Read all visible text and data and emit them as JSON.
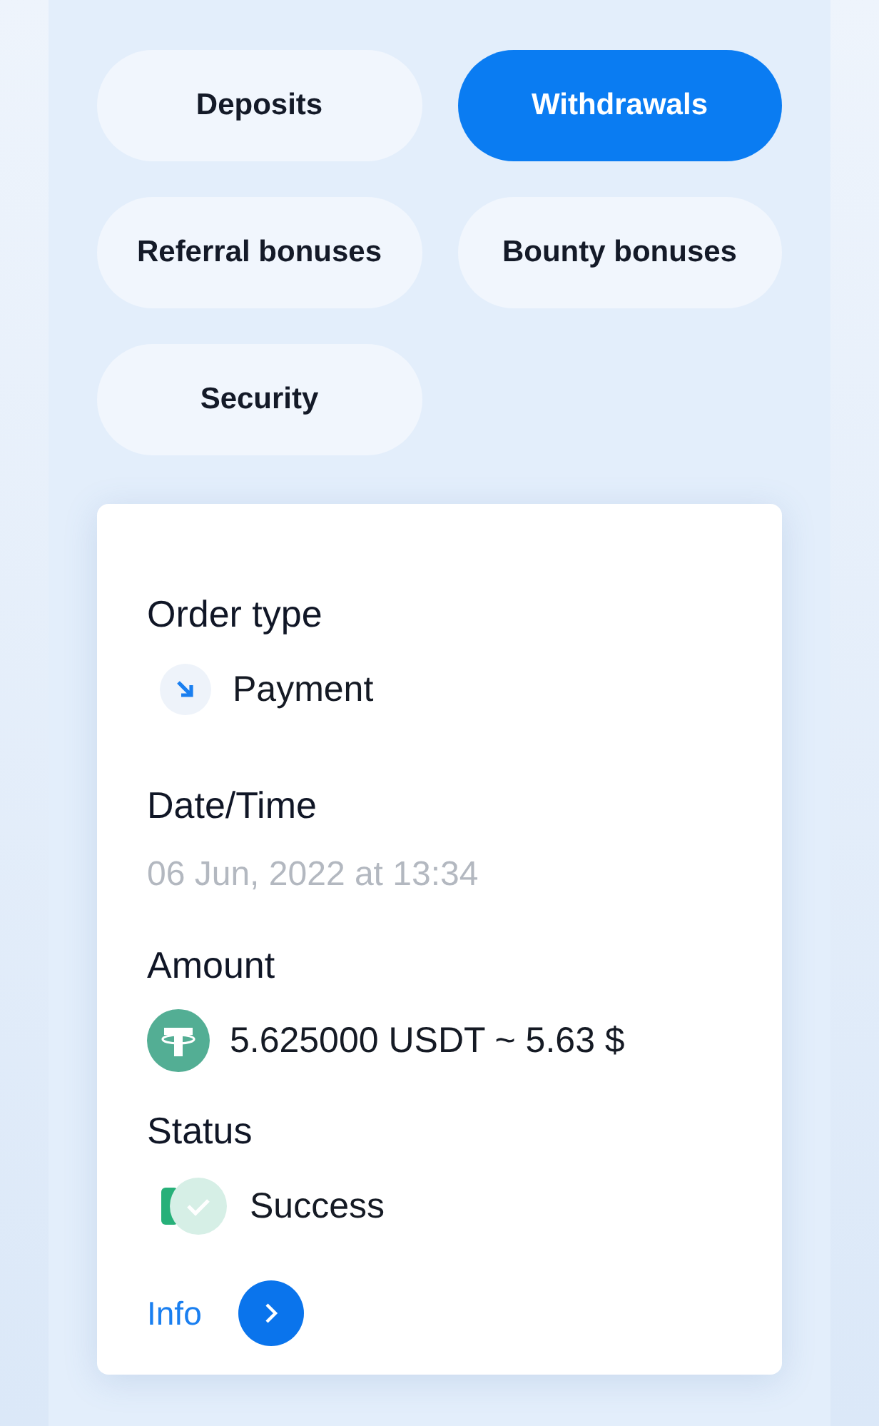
{
  "tabs": [
    {
      "label": "Deposits",
      "selected": false
    },
    {
      "label": "Withdrawals",
      "selected": true
    },
    {
      "label": "Referral bonuses",
      "selected": false
    },
    {
      "label": "Bounty bonuses",
      "selected": false
    },
    {
      "label": "Security",
      "selected": false
    }
  ],
  "details": [
    {
      "label": "Order type",
      "value": "Payment",
      "kind": "direction"
    },
    {
      "label": "Date/Time",
      "value": "06 Jun, 2022 at 13:34",
      "kind": "muted"
    },
    {
      "label": "Amount",
      "value": "5.625000 USDT ~ 5.63 $",
      "kind": "coin"
    },
    {
      "label": "Status",
      "value": "Success",
      "kind": "status"
    }
  ],
  "info_link": {
    "label": "Info"
  }
}
